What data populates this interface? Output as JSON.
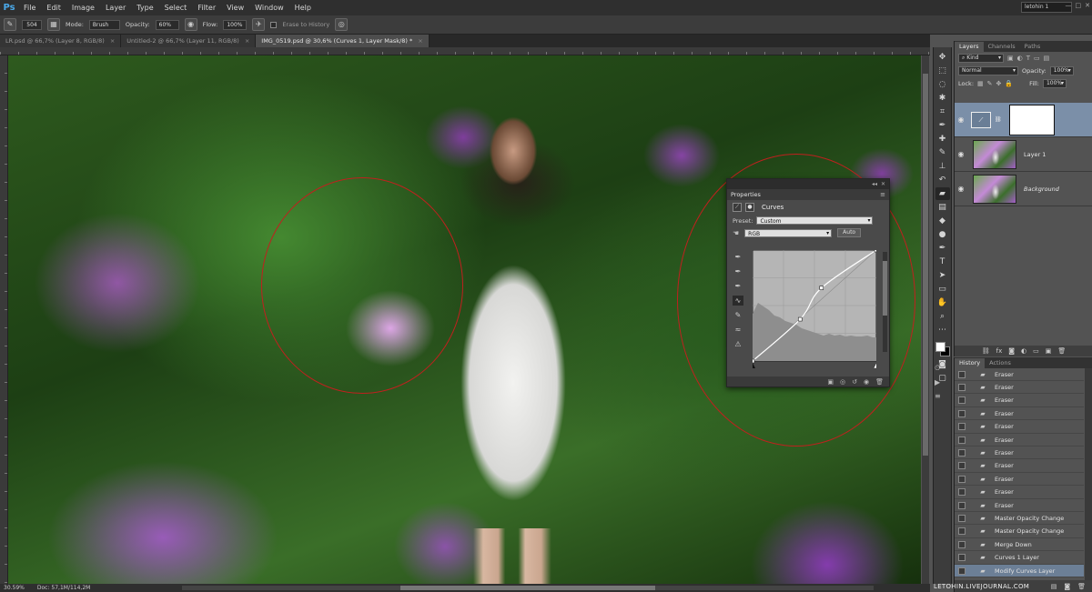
{
  "app": {
    "logo": "Ps",
    "workspace": "letohin 1"
  },
  "menu": [
    "File",
    "Edit",
    "Image",
    "Layer",
    "Type",
    "Select",
    "Filter",
    "View",
    "Window",
    "Help"
  ],
  "window_controls": [
    "—",
    "□",
    "✕"
  ],
  "options": {
    "brush_size": "504",
    "mode_label": "Mode:",
    "mode_value": "Brush",
    "opacity_label": "Opacity:",
    "opacity_value": "60%",
    "flow_label": "Flow:",
    "flow_value": "100%",
    "erase_history_label": "Erase to History"
  },
  "tabs": [
    {
      "label": "LR.psd @ 66,7% (Layer 8, RGB/8)",
      "close": "×"
    },
    {
      "label": "Untitled-2 @ 66,7% (Layer 11, RGB/8)",
      "close": "×"
    },
    {
      "label": "IMG_0519.psd @ 30,6% (Curves 1, Layer Mask/8) *",
      "close": "×"
    }
  ],
  "status": {
    "zoom": "30.59%",
    "doc": "Doc: 57,1M/114,2M"
  },
  "properties": {
    "tab": "Properties",
    "title": "Curves",
    "preset_label": "Preset:",
    "preset_value": "Custom",
    "channel_value": "RGB",
    "auto_label": "Auto",
    "collapse": "◂◂",
    "close": "✕",
    "menu": "≡"
  },
  "curves": {
    "points": [
      [
        0,
        0
      ],
      [
        98,
        96
      ],
      [
        142,
        168
      ],
      [
        255,
        255
      ]
    ],
    "colors": {
      "curve": "#ffffff",
      "histogram": "#8e8e8e",
      "background": "#b5b5b5"
    }
  },
  "layers": {
    "tabs": [
      "Layers",
      "Channels",
      "Paths"
    ],
    "kind_label": "Kind",
    "blend_mode": "Normal",
    "opacity_label": "Opacity:",
    "opacity_value": "100%",
    "lock_label": "Lock:",
    "fill_label": "Fill:",
    "fill_value": "100%",
    "items": [
      {
        "name": "",
        "type": "adjustment"
      },
      {
        "name": "Layer 1",
        "type": "pixel"
      },
      {
        "name": "Background",
        "type": "pixel"
      }
    ]
  },
  "history": {
    "tabs": [
      "History",
      "Actions"
    ],
    "items": [
      "Eraser",
      "Eraser",
      "Eraser",
      "Eraser",
      "Eraser",
      "Eraser",
      "Eraser",
      "Eraser",
      "Eraser",
      "Eraser",
      "Eraser",
      "Master Opacity Change",
      "Master Opacity Change",
      "Merge Down",
      "Curves 1 Layer",
      "Modify Curves Layer"
    ],
    "active_index": 15
  },
  "watermark": "LETOHIN.LIVEJOURNAL.COM"
}
